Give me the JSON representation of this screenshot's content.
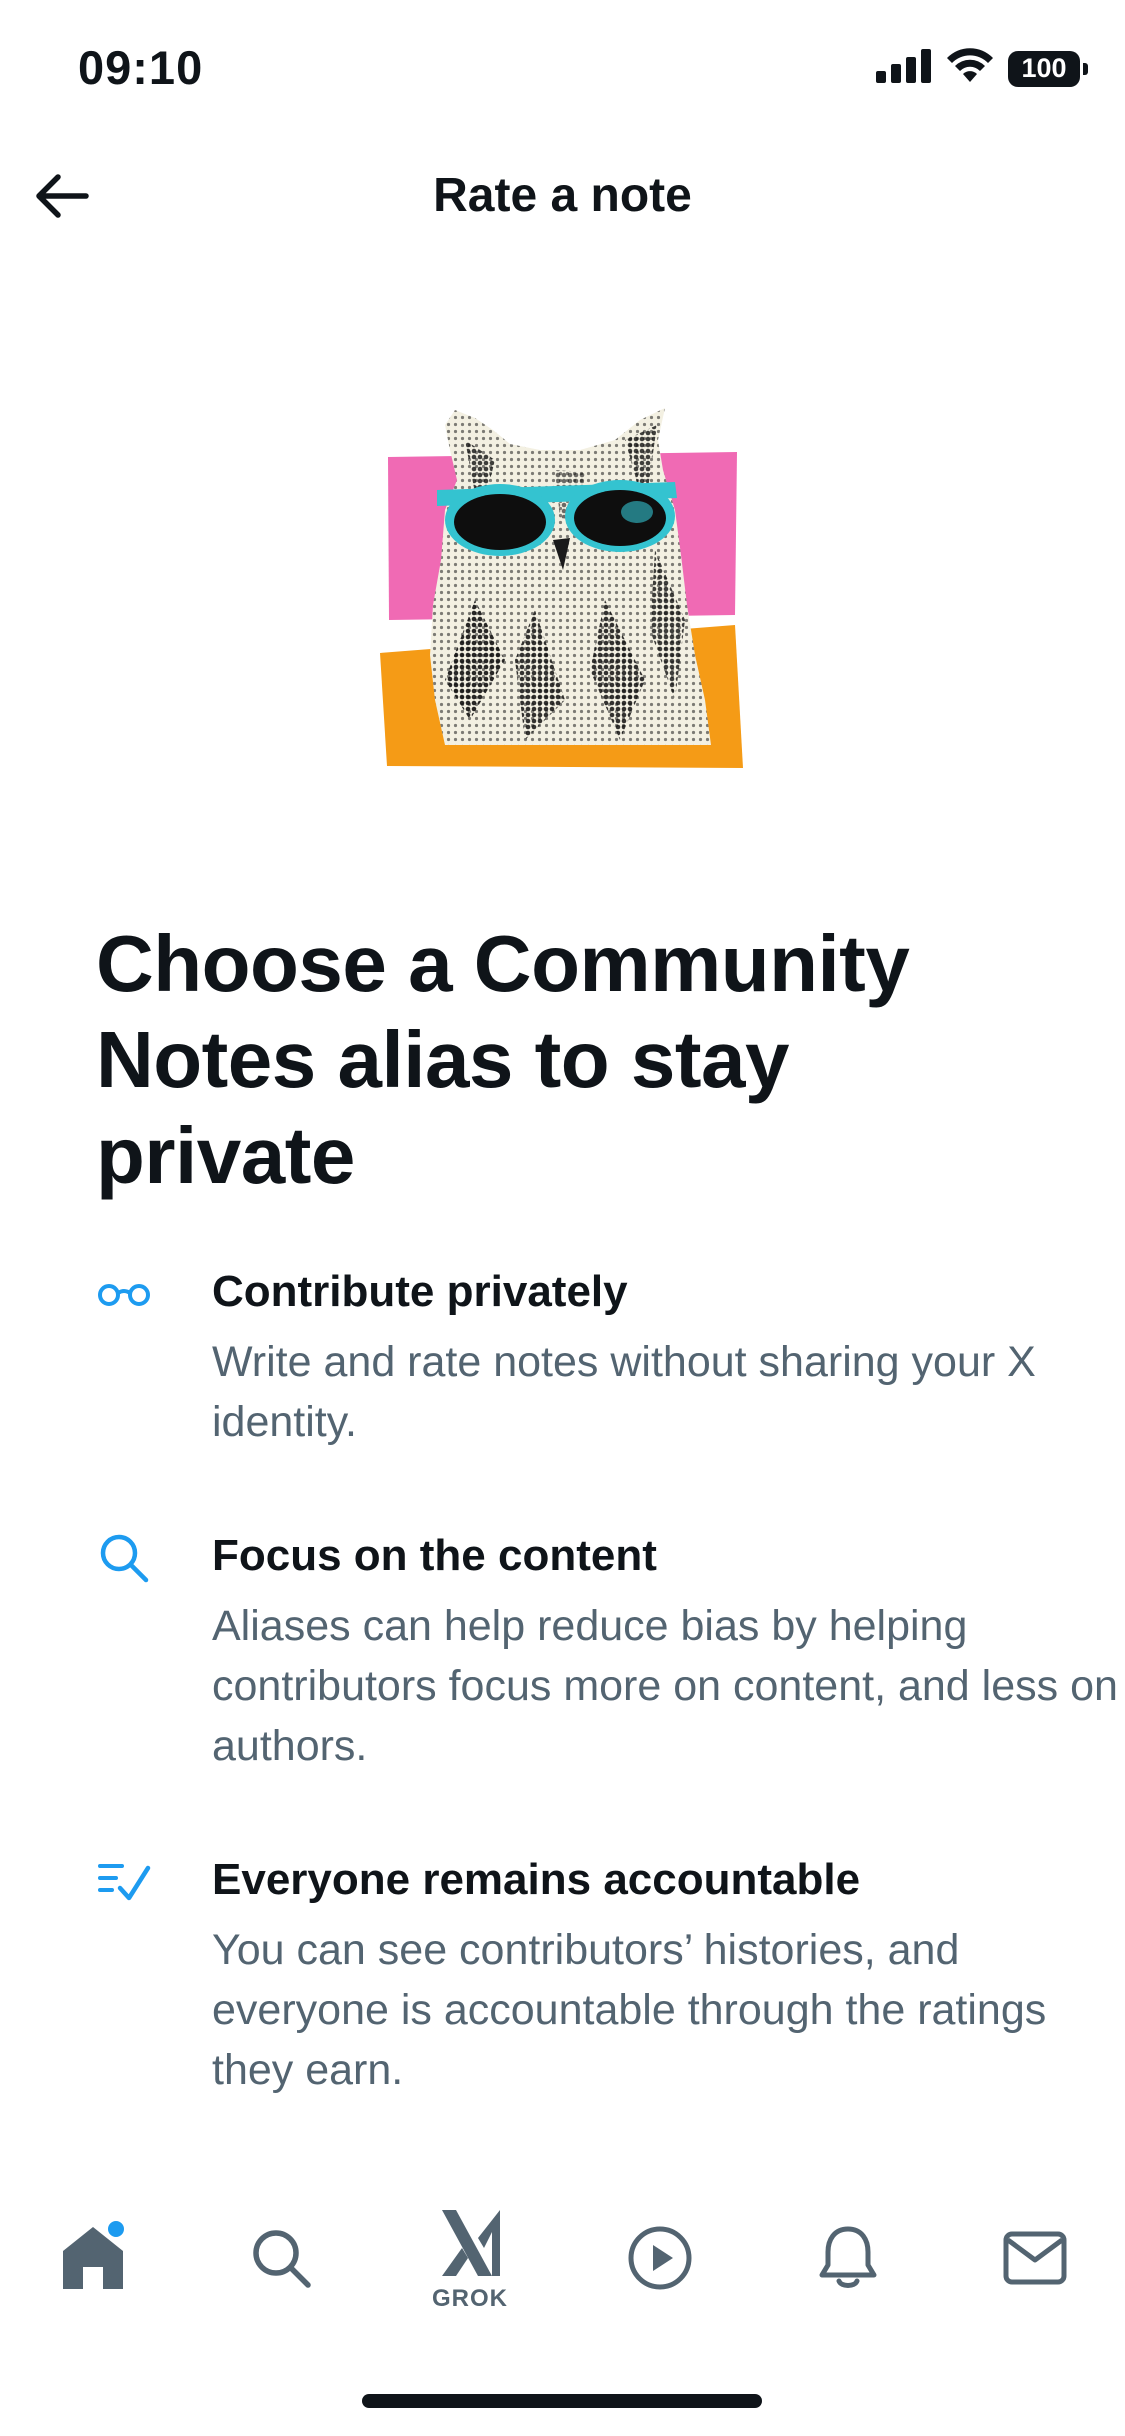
{
  "status_bar": {
    "time": "09:10",
    "battery": "100"
  },
  "header": {
    "title": "Rate a note",
    "back_icon": "arrow-left-icon"
  },
  "hero_image": {
    "subject": "owl-with-sunglasses-illustration",
    "colors": {
      "pink": "#f06ab4",
      "orange": "#f59b16",
      "lens": "#34c3d0"
    }
  },
  "headline": "Choose a Community Notes alias to stay private",
  "features": [
    {
      "icon": "glasses-icon",
      "title": "Contribute privately",
      "description": "Write and rate notes without sharing your X identity."
    },
    {
      "icon": "search-icon",
      "title": "Focus on the content",
      "description": "Aliases can help reduce bias by helping contributors focus more on content, and less on authors."
    },
    {
      "icon": "checklist-icon",
      "title": "Everyone remains accountable",
      "description": "You can see contributors’ histories, and everyone is accountable through the ratings they earn."
    }
  ],
  "tab_bar": {
    "items": [
      {
        "name": "home",
        "icon": "home-icon",
        "active": true,
        "has_notification_dot": true
      },
      {
        "name": "search",
        "icon": "search-icon"
      },
      {
        "name": "grok",
        "icon": "grok-icon",
        "label": "GROK"
      },
      {
        "name": "video",
        "icon": "play-icon"
      },
      {
        "name": "notifications",
        "icon": "bell-icon"
      },
      {
        "name": "messages",
        "icon": "mail-icon"
      }
    ]
  },
  "colors": {
    "accent": "#1d9bf0",
    "text_primary": "#0f1419",
    "text_secondary": "#536471",
    "tab_icon": "#536471"
  }
}
